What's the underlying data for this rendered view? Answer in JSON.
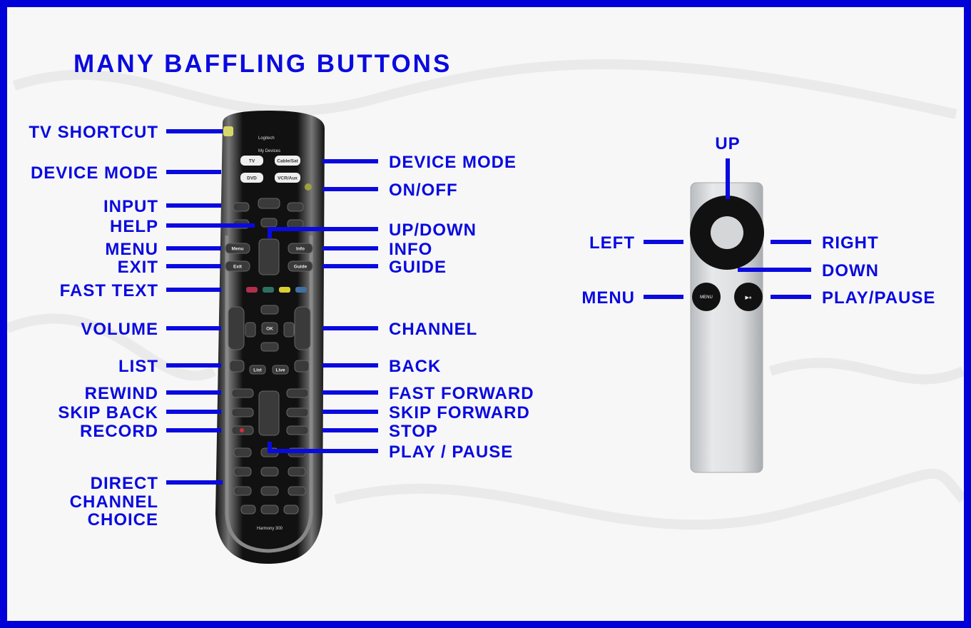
{
  "title": "MANY BAFFLING BUTTONS",
  "colors": {
    "accent": "#0a0ae0",
    "frame": "#0000d8",
    "background": "#f7f7f7"
  },
  "harmony_remote": {
    "brand": "Logitech",
    "model": "Harmony 300",
    "left_labels": [
      "TV SHORTCUT",
      "DEVICE MODE",
      "INPUT",
      "HELP",
      "MENU",
      "EXIT",
      "FAST TEXT",
      "VOLUME",
      "LIST",
      "REWIND",
      "SKIP BACK",
      "RECORD"
    ],
    "direct_channel": [
      "DIRECT",
      "CHANNEL",
      "CHOICE"
    ],
    "right_labels": [
      "DEVICE MODE",
      "ON/OFF",
      "UP/DOWN",
      "INFO",
      "GUIDE",
      "CHANNEL",
      "BACK",
      "FAST FORWARD",
      "SKIP FORWARD",
      "STOP",
      "PLAY / PAUSE"
    ],
    "button_text": {
      "my_devices": "My Devices",
      "tv": "TV",
      "cable": "Cable/Sat",
      "dvd": "DVD",
      "vcr": "VCR/Aux",
      "menu": "Menu",
      "info": "Info",
      "exit": "Exit",
      "guide": "Guide",
      "ok": "OK",
      "list": "List",
      "live": "Live"
    }
  },
  "apple_remote": {
    "labels": {
      "up": "UP",
      "left": "LEFT",
      "right": "RIGHT",
      "down": "DOWN",
      "menu": "MENU",
      "play_pause": "PLAY/PAUSE"
    },
    "button_text": {
      "menu": "MENU",
      "play": "▶⏸"
    }
  }
}
